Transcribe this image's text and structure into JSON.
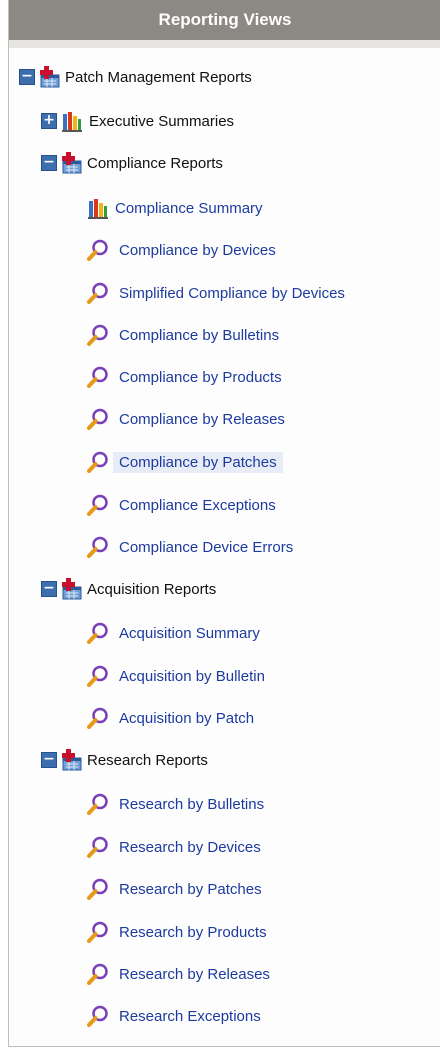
{
  "header": {
    "title": "Reporting Views"
  },
  "colors": {
    "header_bg": "#8c8883",
    "link": "#1d3b9f",
    "toggle": "#3d6faf"
  },
  "tree": {
    "root": {
      "label": "Patch Management Reports",
      "toggle": "−",
      "icon": "folder-plus-icon"
    },
    "executive": {
      "label": "Executive Summaries",
      "toggle": "+",
      "icon": "bar-chart-icon"
    },
    "compliance": {
      "label": "Compliance Reports",
      "toggle": "−",
      "icon": "folder-plus-icon",
      "items": [
        "Compliance Summary",
        "Compliance by Devices",
        "Simplified Compliance by Devices",
        "Compliance by Bulletins",
        "Compliance by Products",
        "Compliance by Releases",
        "Compliance by  Patches",
        "Compliance Exceptions",
        "Compliance Device Errors"
      ]
    },
    "acquisition": {
      "label": "Acquisition Reports",
      "toggle": "−",
      "icon": "folder-plus-icon",
      "items": [
        "Acquisition Summary",
        "Acquisition by Bulletin",
        "Acquisition by Patch"
      ]
    },
    "research": {
      "label": "Research Reports",
      "toggle": "−",
      "icon": "folder-plus-icon",
      "items": [
        "Research by Bulletins",
        "Research by Devices",
        "Research by Patches",
        "Research by Products",
        "Research by Releases",
        "Research Exceptions"
      ]
    }
  }
}
